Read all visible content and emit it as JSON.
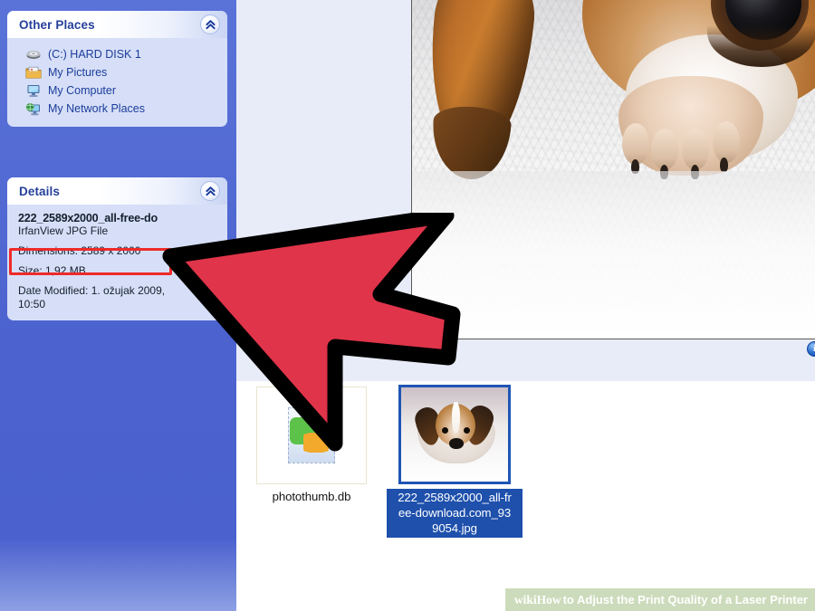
{
  "sidebar": {
    "panels": [
      {
        "title": "Other Places",
        "collapse_icon": "chevron-double-up-icon",
        "items": [
          {
            "label": "(C:) HARD DISK 1",
            "icon": "hard-disk-icon"
          },
          {
            "label": "My Pictures",
            "icon": "pictures-folder-icon"
          },
          {
            "label": "My Computer",
            "icon": "my-computer-icon"
          },
          {
            "label": "My Network Places",
            "icon": "network-places-icon"
          }
        ]
      },
      {
        "title": "Details",
        "collapse_icon": "chevron-double-up-icon",
        "file_name": "222_2589x2000_all-free-do",
        "file_type": "IrfanView JPG File",
        "dimensions": "Dimensions: 2589 x 2000",
        "size": "Size: 1,92 MB",
        "date_modified": "Date Modified: 1. ožujak 2009,",
        "date_modified_2": "10:50"
      }
    ]
  },
  "preview": {
    "image_alt": "beagle puppy close-up",
    "info_icon": "info-circle-icon"
  },
  "thumbnails": [
    {
      "name": "photothumb.db",
      "icon": "database-file-icon",
      "selected": false
    },
    {
      "name_line1": "222_2589x2000_all-fr",
      "name_line2": "ee-download.com_93",
      "name_line3": "9054.jpg",
      "icon": "image-thumbnail-icon",
      "selected": true
    }
  ],
  "annotation": {
    "highlight_target": "Dimensions: 2589 x 2000",
    "highlight_color": "#ef2a2a",
    "arrow_fill": "#e0344a",
    "arrow_stroke": "#000000"
  },
  "watermark": {
    "brand": "wiki",
    "brand_bold": "How",
    "text": " to Adjust the Print Quality of a Laser Printer",
    "background": "#c8d8b5"
  }
}
